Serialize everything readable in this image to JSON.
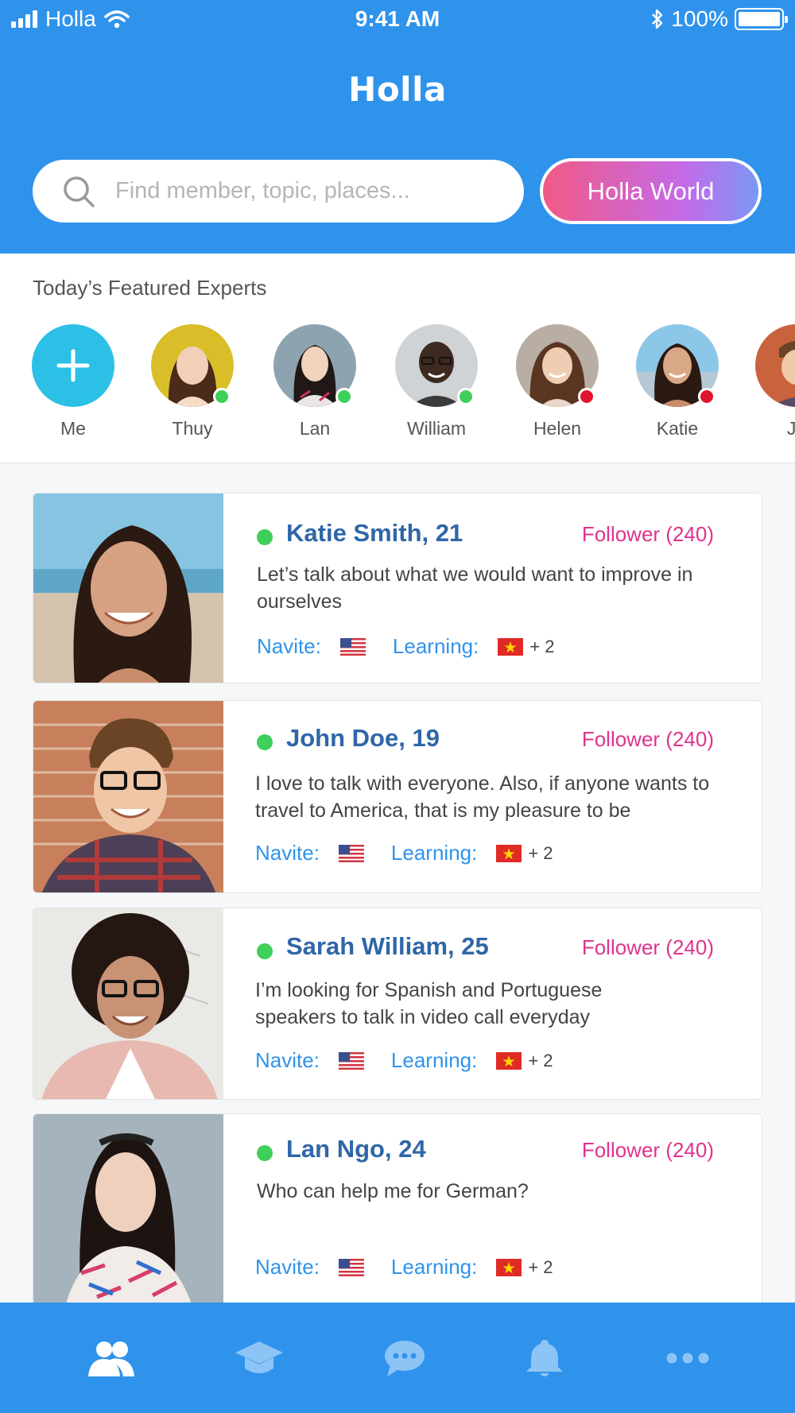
{
  "status_bar": {
    "carrier": "Holla",
    "time": "9:41 AM",
    "battery": "100%"
  },
  "header": {
    "logo": "Holla",
    "search_placeholder": "Find member, topic, places...",
    "world_button": "Holla World"
  },
  "featured": {
    "title": "Today’s Featured Experts",
    "me_label": "Me",
    "experts": [
      {
        "name": "Thuy",
        "status": "online"
      },
      {
        "name": "Lan",
        "status": "online"
      },
      {
        "name": "William",
        "status": "online"
      },
      {
        "name": "Helen",
        "status": "busy"
      },
      {
        "name": "Katie",
        "status": "busy"
      },
      {
        "name": "Jo",
        "status": ""
      }
    ]
  },
  "cards": [
    {
      "name": "Katie Smith, 21",
      "followers": "Follower (240)",
      "bio": "Let’s talk about what we would want to improve in ourselves",
      "native_label": "Navite:",
      "learning_label": "Learning:",
      "extra": "+ 2"
    },
    {
      "name": "John Doe, 19",
      "followers": "Follower (240)",
      "bio": "I love to talk with everyone. Also, if anyone wants to travel to America, that is my pleasure to be",
      "native_label": "Navite:",
      "learning_label": "Learning:",
      "extra": "+ 2"
    },
    {
      "name": "Sarah William, 25",
      "followers": "Follower (240)",
      "bio": "I’m looking for Spanish and Portuguese speakers to talk in video call everyday",
      "native_label": "Navite:",
      "learning_label": "Learning:",
      "extra": "+ 2"
    },
    {
      "name": "Lan Ngo, 24",
      "followers": "Follower (240)",
      "bio": "Who can help me for German?",
      "native_label": "Navite:",
      "learning_label": "Learning:",
      "extra": "+ 2"
    }
  ],
  "tabs": [
    {
      "icon": "people-icon",
      "active": true
    },
    {
      "icon": "graduation-cap-icon",
      "active": false
    },
    {
      "icon": "chat-bubble-icon",
      "active": false
    },
    {
      "icon": "bell-icon",
      "active": false
    },
    {
      "icon": "more-icon",
      "active": false
    }
  ],
  "colors": {
    "primary": "#2f93ec",
    "online": "#3fcf5b",
    "busy": "#e0142d",
    "follower": "#e0338d",
    "name": "#2f66a8",
    "add": "#2cc0e6"
  }
}
